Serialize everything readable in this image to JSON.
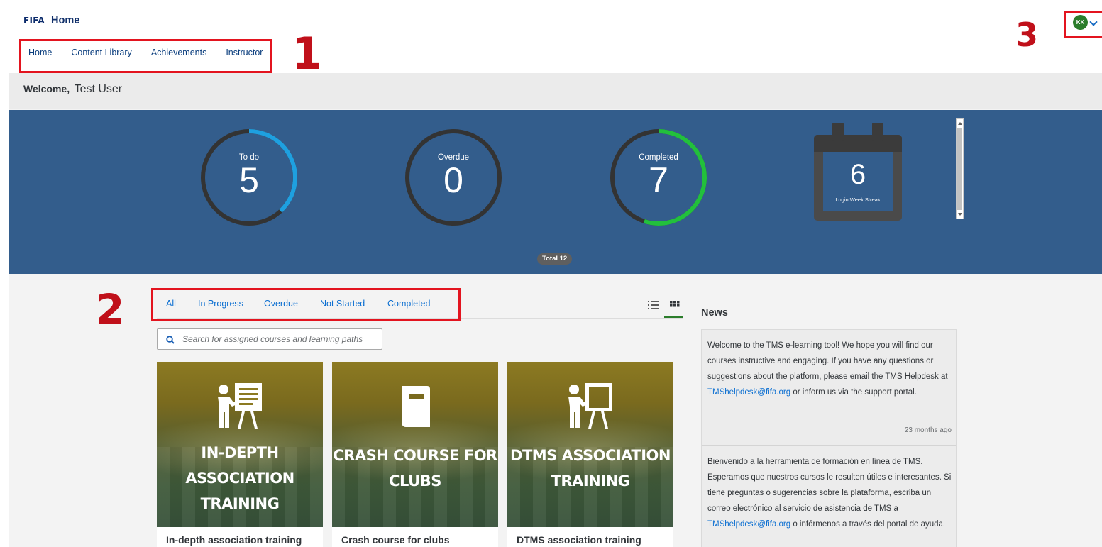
{
  "header": {
    "logo": "FIFA",
    "title": "Home",
    "nav": [
      "Home",
      "Content Library",
      "Achievements",
      "Instructor"
    ],
    "avatar_initials": "KK"
  },
  "welcome": {
    "prefix": "Welcome,",
    "name": "Test User"
  },
  "stats": {
    "todo": {
      "label": "To do",
      "value": "5",
      "progress": 0.38,
      "color": "#1ea0e0"
    },
    "overdue": {
      "label": "Overdue",
      "value": "0",
      "progress": 0,
      "color": "#e0a01e"
    },
    "completed": {
      "label": "Completed",
      "value": "7",
      "progress": 0.55,
      "color": "#22c03c"
    },
    "streak": {
      "value": "6",
      "label": "Login Week Streak"
    },
    "total": "Total 12"
  },
  "tabs": [
    "All",
    "In Progress",
    "Overdue",
    "Not Started",
    "Completed"
  ],
  "search": {
    "placeholder": "Search for assigned courses and learning paths"
  },
  "courses": [
    {
      "overlay": [
        "IN-DEPTH",
        "ASSOCIATION",
        "TRAINING"
      ],
      "name": "In-depth association training",
      "icon": "instructor-board-icon"
    },
    {
      "overlay": [
        "CRASH COURSE FOR",
        "CLUBS"
      ],
      "name": "Crash course for clubs",
      "icon": "book-icon"
    },
    {
      "overlay": [
        "DTMS ASSOCIATION",
        "TRAINING"
      ],
      "name": "DTMS association training",
      "icon": "instructor-board-icon"
    }
  ],
  "news": {
    "title": "News",
    "items": [
      {
        "before": "Welcome to the TMS e-learning tool! We hope you will find our courses instructive and engaging. If you have any questions or suggestions about the platform, please email the TMS Helpdesk at ",
        "link": "TMShelpdesk@fifa.org",
        "after": " or inform us via the support portal.",
        "time": "23 months ago"
      },
      {
        "before": "Bienvenido a la herramienta de formación en línea de TMS. Esperamos que nuestros cursos le resulten útiles e interesantes. Si tiene preguntas o sugerencias sobre la plataforma, escriba un correo electrónico al servicio de asistencia de TMS a ",
        "link": "TMShelpdesk@fifa.org",
        "after": " o infórmenos a través del portal de ayuda.",
        "time": ""
      }
    ]
  },
  "annotations": [
    "1",
    "2",
    "3"
  ]
}
